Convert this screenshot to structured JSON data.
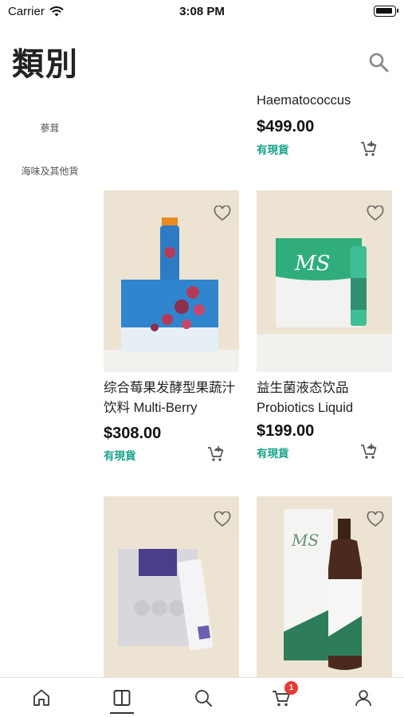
{
  "status_bar": {
    "carrier": "Carrier",
    "time": "3:08 PM"
  },
  "header": {
    "title": "類別",
    "search_icon": "search-icon"
  },
  "sidebar": {
    "items": [
      {
        "label": "蔘茸"
      },
      {
        "label": "海味及其他貨"
      }
    ]
  },
  "products": {
    "top_partial": {
      "name": "Haematococcus",
      "price": "$499.00",
      "stock": "有現貨"
    },
    "items": [
      {
        "name": "综合莓果发酵型果蔬汁饮料 Multi-Berry",
        "price": "$308.00",
        "stock": "有現貨"
      },
      {
        "name": "益生菌液态饮品 Probiotics Liquid",
        "price": "$199.00",
        "stock": "有現貨"
      },
      {
        "name": "",
        "price": "",
        "stock": ""
      },
      {
        "name": "",
        "price": "",
        "stock": ""
      }
    ]
  },
  "tabbar": {
    "tabs": [
      {
        "icon": "home-icon"
      },
      {
        "icon": "book-icon",
        "active": true
      },
      {
        "icon": "search-icon"
      },
      {
        "icon": "cart-icon",
        "badge": "1"
      },
      {
        "icon": "user-icon"
      }
    ]
  },
  "colors": {
    "accent": "#17a38a",
    "badge": "#e53935",
    "image_bg": "#ece3d2"
  }
}
